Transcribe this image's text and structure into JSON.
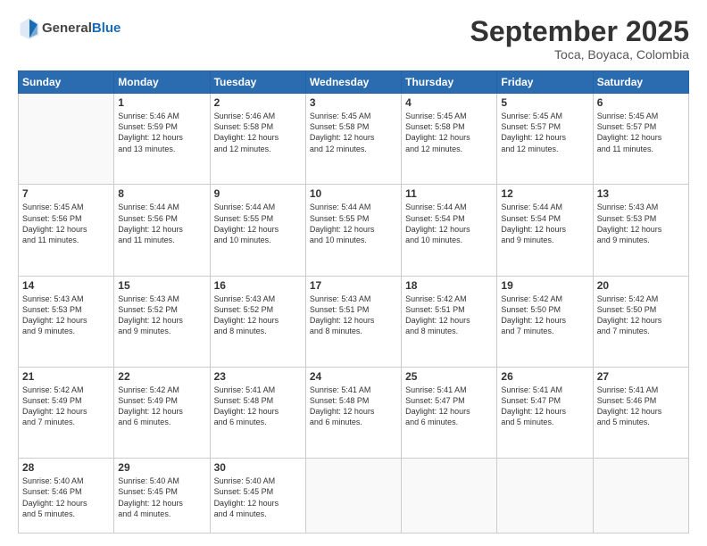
{
  "header": {
    "logo": {
      "general": "General",
      "blue": "Blue"
    },
    "title": "September 2025",
    "location": "Toca, Boyaca, Colombia"
  },
  "weekdays": [
    "Sunday",
    "Monday",
    "Tuesday",
    "Wednesday",
    "Thursday",
    "Friday",
    "Saturday"
  ],
  "weeks": [
    [
      {
        "day": "",
        "info": ""
      },
      {
        "day": "1",
        "info": "Sunrise: 5:46 AM\nSunset: 5:59 PM\nDaylight: 12 hours\nand 13 minutes."
      },
      {
        "day": "2",
        "info": "Sunrise: 5:46 AM\nSunset: 5:58 PM\nDaylight: 12 hours\nand 12 minutes."
      },
      {
        "day": "3",
        "info": "Sunrise: 5:45 AM\nSunset: 5:58 PM\nDaylight: 12 hours\nand 12 minutes."
      },
      {
        "day": "4",
        "info": "Sunrise: 5:45 AM\nSunset: 5:58 PM\nDaylight: 12 hours\nand 12 minutes."
      },
      {
        "day": "5",
        "info": "Sunrise: 5:45 AM\nSunset: 5:57 PM\nDaylight: 12 hours\nand 12 minutes."
      },
      {
        "day": "6",
        "info": "Sunrise: 5:45 AM\nSunset: 5:57 PM\nDaylight: 12 hours\nand 11 minutes."
      }
    ],
    [
      {
        "day": "7",
        "info": "Sunrise: 5:45 AM\nSunset: 5:56 PM\nDaylight: 12 hours\nand 11 minutes."
      },
      {
        "day": "8",
        "info": "Sunrise: 5:44 AM\nSunset: 5:56 PM\nDaylight: 12 hours\nand 11 minutes."
      },
      {
        "day": "9",
        "info": "Sunrise: 5:44 AM\nSunset: 5:55 PM\nDaylight: 12 hours\nand 10 minutes."
      },
      {
        "day": "10",
        "info": "Sunrise: 5:44 AM\nSunset: 5:55 PM\nDaylight: 12 hours\nand 10 minutes."
      },
      {
        "day": "11",
        "info": "Sunrise: 5:44 AM\nSunset: 5:54 PM\nDaylight: 12 hours\nand 10 minutes."
      },
      {
        "day": "12",
        "info": "Sunrise: 5:44 AM\nSunset: 5:54 PM\nDaylight: 12 hours\nand 9 minutes."
      },
      {
        "day": "13",
        "info": "Sunrise: 5:43 AM\nSunset: 5:53 PM\nDaylight: 12 hours\nand 9 minutes."
      }
    ],
    [
      {
        "day": "14",
        "info": "Sunrise: 5:43 AM\nSunset: 5:53 PM\nDaylight: 12 hours\nand 9 minutes."
      },
      {
        "day": "15",
        "info": "Sunrise: 5:43 AM\nSunset: 5:52 PM\nDaylight: 12 hours\nand 9 minutes."
      },
      {
        "day": "16",
        "info": "Sunrise: 5:43 AM\nSunset: 5:52 PM\nDaylight: 12 hours\nand 8 minutes."
      },
      {
        "day": "17",
        "info": "Sunrise: 5:43 AM\nSunset: 5:51 PM\nDaylight: 12 hours\nand 8 minutes."
      },
      {
        "day": "18",
        "info": "Sunrise: 5:42 AM\nSunset: 5:51 PM\nDaylight: 12 hours\nand 8 minutes."
      },
      {
        "day": "19",
        "info": "Sunrise: 5:42 AM\nSunset: 5:50 PM\nDaylight: 12 hours\nand 7 minutes."
      },
      {
        "day": "20",
        "info": "Sunrise: 5:42 AM\nSunset: 5:50 PM\nDaylight: 12 hours\nand 7 minutes."
      }
    ],
    [
      {
        "day": "21",
        "info": "Sunrise: 5:42 AM\nSunset: 5:49 PM\nDaylight: 12 hours\nand 7 minutes."
      },
      {
        "day": "22",
        "info": "Sunrise: 5:42 AM\nSunset: 5:49 PM\nDaylight: 12 hours\nand 6 minutes."
      },
      {
        "day": "23",
        "info": "Sunrise: 5:41 AM\nSunset: 5:48 PM\nDaylight: 12 hours\nand 6 minutes."
      },
      {
        "day": "24",
        "info": "Sunrise: 5:41 AM\nSunset: 5:48 PM\nDaylight: 12 hours\nand 6 minutes."
      },
      {
        "day": "25",
        "info": "Sunrise: 5:41 AM\nSunset: 5:47 PM\nDaylight: 12 hours\nand 6 minutes."
      },
      {
        "day": "26",
        "info": "Sunrise: 5:41 AM\nSunset: 5:47 PM\nDaylight: 12 hours\nand 5 minutes."
      },
      {
        "day": "27",
        "info": "Sunrise: 5:41 AM\nSunset: 5:46 PM\nDaylight: 12 hours\nand 5 minutes."
      }
    ],
    [
      {
        "day": "28",
        "info": "Sunrise: 5:40 AM\nSunset: 5:46 PM\nDaylight: 12 hours\nand 5 minutes."
      },
      {
        "day": "29",
        "info": "Sunrise: 5:40 AM\nSunset: 5:45 PM\nDaylight: 12 hours\nand 4 minutes."
      },
      {
        "day": "30",
        "info": "Sunrise: 5:40 AM\nSunset: 5:45 PM\nDaylight: 12 hours\nand 4 minutes."
      },
      {
        "day": "",
        "info": ""
      },
      {
        "day": "",
        "info": ""
      },
      {
        "day": "",
        "info": ""
      },
      {
        "day": "",
        "info": ""
      }
    ]
  ]
}
